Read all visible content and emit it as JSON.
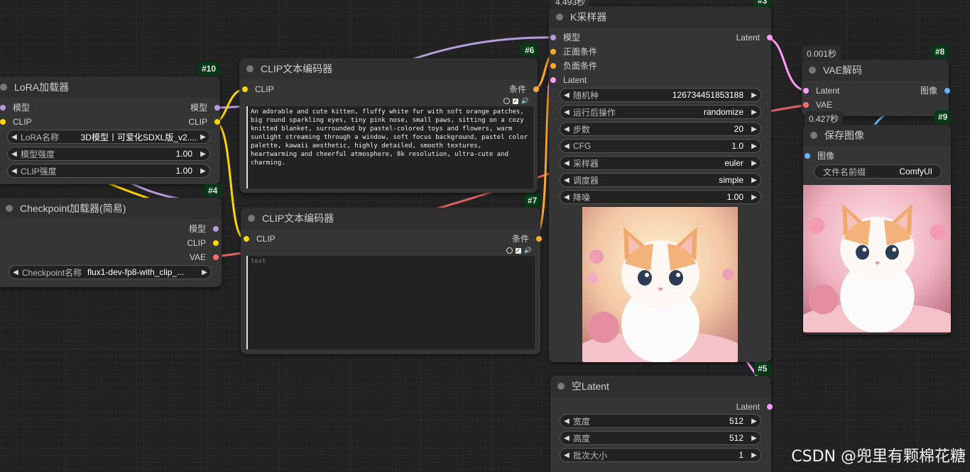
{
  "colors": {
    "model": "#b39ddb",
    "clip": "#ffd500",
    "vae": "#ff6e6e",
    "cond": "#ffa931",
    "latent": "#ff9cf9",
    "image": "#64b5f6"
  },
  "nodes": {
    "lora": {
      "title": "LoRA加载器",
      "id": "#10",
      "in_model": "模型",
      "in_clip": "CLIP",
      "out_model": "模型",
      "out_clip": "CLIP",
      "w_name_label": "LoRA名称",
      "w_name_value": "3D模型丨可爱化SDXL版_v2....",
      "w_model_label": "模型强度",
      "w_model_value": "1.00",
      "w_clip_label": "CLIP强度",
      "w_clip_value": "1.00"
    },
    "checkpoint": {
      "title": "Checkpoint加载器(简易)",
      "id": "#4",
      "out_model": "模型",
      "out_clip": "CLIP",
      "out_vae": "VAE",
      "w_label": "Checkpoint名称",
      "w_value": "flux1-dev-fp8-with_clip_..."
    },
    "clip6": {
      "title": "CLIP文本编码器",
      "id": "#6",
      "in_clip": "CLIP",
      "out": "条件",
      "text": "An adorable and cute kitten, fluffy white fur with soft orange patches, big round sparkling eyes, tiny pink nose, small paws, sitting on a cozy knitted blanket, surrounded by pastel-colored toys and flowers, warm sunlight streaming through a window, soft focus background, pastel color palette, kawaii aesthetic, highly detailed, smooth textures, heartwarming and cheerful atmosphere, 8k resolution, ultra-cute and charming."
    },
    "clip7": {
      "title": "CLIP文本编码器",
      "id": "#7",
      "in_clip": "CLIP",
      "out": "条件",
      "placeholder": "text"
    },
    "ksampler": {
      "title": "K采样器",
      "timing": "4.493秒",
      "id": "#3",
      "in_model": "模型",
      "in_pos": "正面条件",
      "in_neg": "负面条件",
      "in_latent": "Latent",
      "out": "Latent",
      "widgets": [
        {
          "label": "随机种",
          "value": "126734451853188"
        },
        {
          "label": "运行后操作",
          "value": "randomize"
        },
        {
          "label": "步数",
          "value": "20"
        },
        {
          "label": "CFG",
          "value": "1.0"
        },
        {
          "label": "采样器",
          "value": "euler"
        },
        {
          "label": "调度器",
          "value": "simple"
        },
        {
          "label": "降噪",
          "value": "1.00"
        }
      ]
    },
    "vae": {
      "title": "VAE解码",
      "timing": "0.001秒",
      "id": "#8",
      "in_latent": "Latent",
      "in_vae": "VAE",
      "out": "图像"
    },
    "save": {
      "title": "保存图像",
      "timing": "0.427秒",
      "id": "#9",
      "in_image": "图像",
      "w_label": "文件名前缀",
      "w_value": "ComfyUI"
    },
    "latent": {
      "title": "空Latent",
      "id": "#5",
      "out": "Latent",
      "widgets": [
        {
          "label": "宽度",
          "value": "512"
        },
        {
          "label": "高度",
          "value": "512"
        },
        {
          "label": "批次大小",
          "value": "1"
        }
      ]
    }
  },
  "watermark": "CSDN @兜里有颗棉花糖"
}
